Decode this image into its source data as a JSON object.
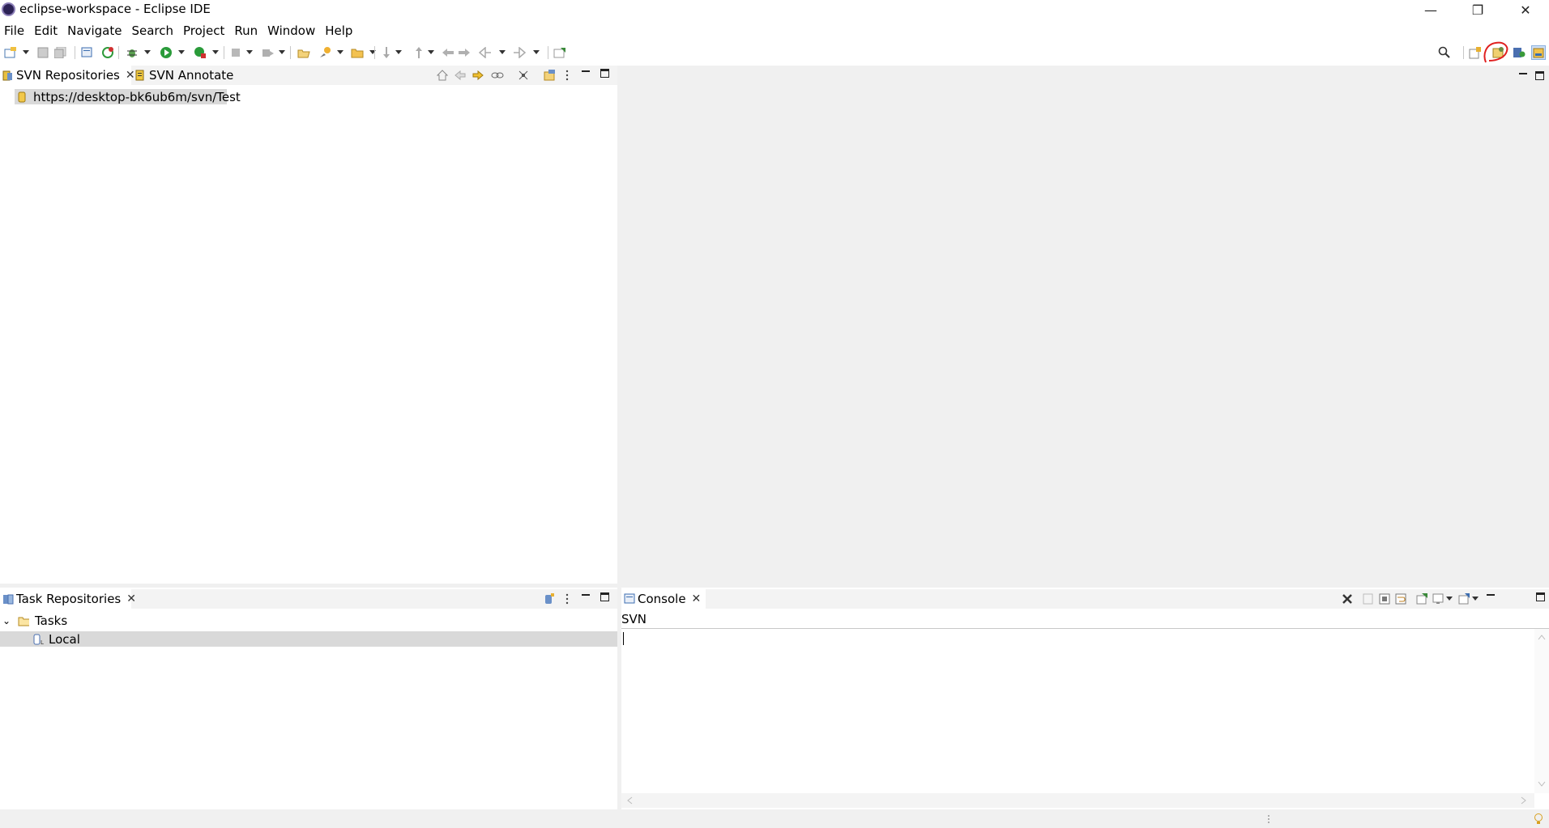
{
  "window": {
    "title": "eclipse-workspace - Eclipse IDE",
    "minimize_glyph": "—",
    "restore_glyph": "❐",
    "close_glyph": "✕"
  },
  "menu": [
    "File",
    "Edit",
    "Navigate",
    "Search",
    "Project",
    "Run",
    "Window",
    "Help"
  ],
  "toolbar": {
    "icons": [
      "new-icon",
      "save-icon",
      "save-all-icon",
      "terminal-icon",
      "refresh-icon",
      "debug-icon",
      "run-icon",
      "external-tools-icon",
      "stop-icon",
      "skip-icon",
      "open-type-icon",
      "open-task-icon",
      "open-folder-icon",
      "next-annotation-icon",
      "prev-annotation-icon",
      "last-edit-icon",
      "back-icon",
      "forward-icon",
      "pin-icon"
    ],
    "right_icons": [
      "search-icon",
      "open-perspective-icon",
      "svn-perspective-icon",
      "java-perspective-icon",
      "resource-perspective-icon"
    ]
  },
  "svn_repositories_panel": {
    "tabs": [
      {
        "label": "SVN Repositories",
        "icon": "svn-repo-icon",
        "active": true,
        "close": "✕"
      },
      {
        "label": "SVN Annotate",
        "icon": "svn-annotate-icon",
        "active": false
      }
    ],
    "items": [
      {
        "label": "https://desktop-bk6ub6m/svn/Test",
        "icon": "repository-icon",
        "selected": true
      }
    ]
  },
  "editor_area": {
    "empty": true
  },
  "task_repositories_panel": {
    "tabs": [
      {
        "label": "Task Repositories",
        "icon": "task-repo-icon",
        "active": true,
        "close": "✕"
      }
    ],
    "items": [
      {
        "label": "Tasks",
        "icon": "folder-icon",
        "expanded": true,
        "level": 0,
        "toggle": "⌄"
      },
      {
        "label": "Local",
        "icon": "local-repo-icon",
        "level": 1,
        "selected": true
      }
    ]
  },
  "console_panel": {
    "tabs": [
      {
        "label": "Console",
        "icon": "console-icon",
        "active": true,
        "close": "✕"
      }
    ],
    "console_name": "SVN",
    "content": ""
  },
  "colors": {
    "selection": "#d9d9d9",
    "header_bg": "#f3f3f3",
    "editor_bg": "#f0f0f0",
    "highlight_circle": "#e02020"
  }
}
